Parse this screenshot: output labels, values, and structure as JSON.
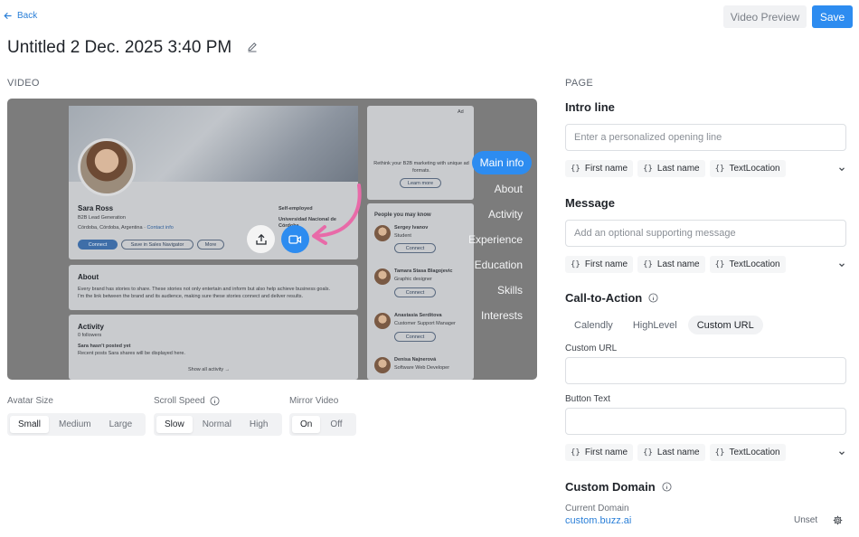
{
  "header": {
    "back_label": "Back",
    "title": "Untitled 2 Dec. 2025 3:40 PM",
    "video_preview_label": "Video Preview",
    "save_label": "Save"
  },
  "video_section": {
    "label": "VIDEO",
    "preview": {
      "profile_name": "Sara Ross",
      "profile_headline": "B2B Lead Generation",
      "profile_location": "Córdoba, Córdoba, Argentina",
      "contact_info": "Contact info",
      "connect_label": "Connect",
      "sales_nav_label": "Save in Sales Navigator",
      "more_label": "More",
      "employer": "Self-employed",
      "education": "Universidad Nacional de Córdoba",
      "ad_label": "Ad",
      "ad_text": "Rethink your B2B marketing with unique ad formats.",
      "learn_more": "Learn more",
      "pymk_title": "People you may know",
      "people": [
        {
          "name": "Sergey Ivanov",
          "role": "Student",
          "connect": "Connect"
        },
        {
          "name": "Tamara Stasa Blagojevic",
          "role": "Graphic designer",
          "connect": "Connect"
        },
        {
          "name": "Anastasia Serditova",
          "role": "Customer Support Manager",
          "connect": "Connect"
        },
        {
          "name": "Denisa Najnerová",
          "role": "Software Web Developer",
          "connect": ""
        }
      ],
      "about_title": "About",
      "about_text_1": "Every brand has stories to share. These stories not only entertain and inform but also help achieve business goals.",
      "about_text_2": "I'm the link between the brand and its audience, making sure these stories connect and deliver results.",
      "activity_title": "Activity",
      "activity_followers": "0 followers",
      "activity_empty": "Sara hasn't posted yet",
      "activity_sub": "Recent posts Sara shares will be displayed here.",
      "show_all": "Show all activity →"
    },
    "menu": {
      "active": "Main info",
      "items": [
        "About",
        "Activity",
        "Experience",
        "Education",
        "Skills",
        "Interests"
      ]
    },
    "avatar_size": {
      "label": "Avatar Size",
      "options": [
        "Small",
        "Medium",
        "Large"
      ],
      "selected": "Small"
    },
    "scroll_speed": {
      "label": "Scroll Speed",
      "options": [
        "Slow",
        "Normal",
        "High"
      ],
      "selected": "Slow"
    },
    "mirror_video": {
      "label": "Mirror Video",
      "options": [
        "On",
        "Off"
      ],
      "selected": "On"
    }
  },
  "page_section": {
    "label": "PAGE",
    "intro_line": {
      "title": "Intro line",
      "placeholder": "Enter a personalized opening line",
      "chips": [
        "First name",
        "Last name",
        "TextLocation"
      ]
    },
    "message": {
      "title": "Message",
      "placeholder": "Add an optional supporting message",
      "chips": [
        "First name",
        "Last name",
        "TextLocation"
      ]
    },
    "cta": {
      "title": "Call-to-Action",
      "tabs": [
        "Calendly",
        "HighLevel",
        "Custom URL"
      ],
      "selected": "Custom URL",
      "custom_url_label": "Custom URL",
      "custom_url_value": "",
      "button_text_label": "Button Text",
      "button_text_value": "",
      "chips": [
        "First name",
        "Last name",
        "TextLocation"
      ]
    },
    "custom_domain": {
      "title": "Custom Domain",
      "current_label": "Current Domain",
      "domain": "custom.buzz.ai",
      "unset_label": "Unset"
    }
  },
  "colors": {
    "accent": "#2d8cf0",
    "link": "#2a7fd8",
    "arrow_pink": "#e86aa8"
  }
}
